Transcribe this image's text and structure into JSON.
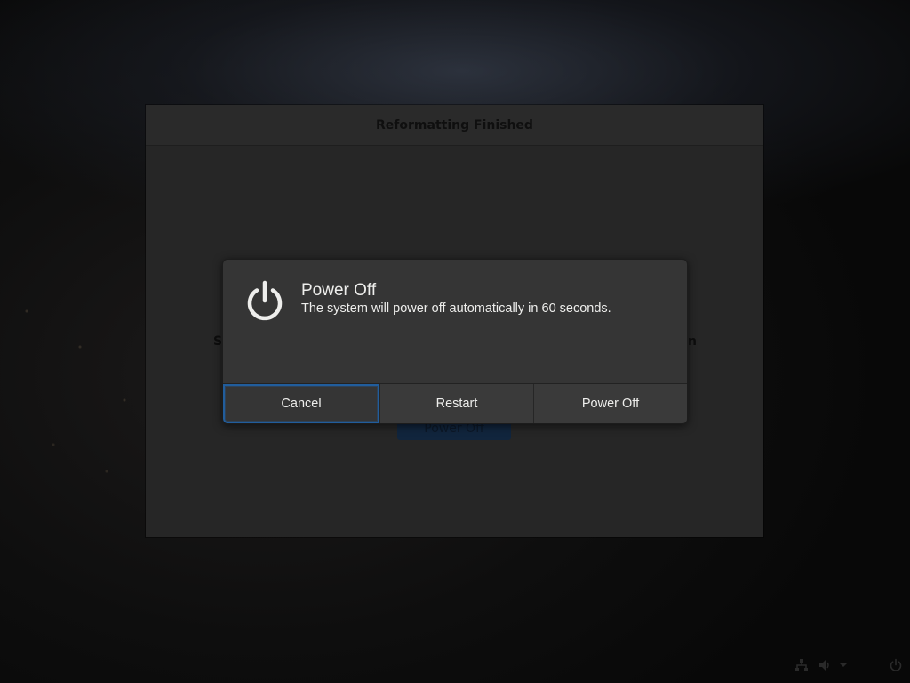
{
  "background_window": {
    "title": "Reformatting Finished",
    "text_left_fragment": "S",
    "text_right_fragment": "n",
    "poweroff_button_label": "Power Off"
  },
  "dialog": {
    "icon": "power-icon",
    "title": "Power Off",
    "message": "The system will power off automatically in 60 seconds.",
    "buttons": {
      "cancel": "Cancel",
      "restart": "Restart",
      "power_off": "Power Off"
    },
    "focused_button": "Cancel",
    "accent_color": "#215d9c"
  },
  "tray": {
    "icons": [
      "network-icon",
      "volume-icon",
      "dropdown-arrow-icon",
      "power-icon"
    ]
  }
}
